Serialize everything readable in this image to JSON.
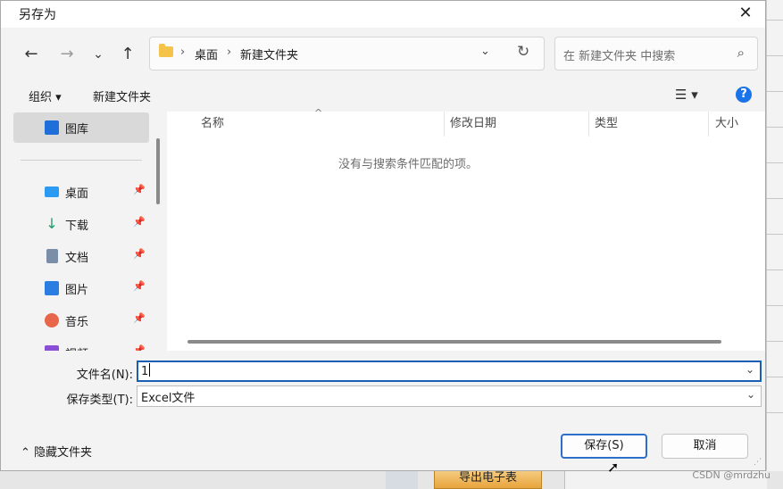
{
  "dialog": {
    "title": "另存为",
    "close_icon": "close-icon"
  },
  "nav": {
    "back": "←",
    "forward": "→",
    "recent": "⌄",
    "up": "↑",
    "breadcrumb": [
      "桌面",
      "新建文件夹"
    ],
    "crumb_sep": "›",
    "dropdown": "⌄",
    "refresh": "↻",
    "search_placeholder": "在 新建文件夹 中搜索",
    "search_icon": "⌕"
  },
  "toolbar": {
    "organize": "组织 ▾",
    "new_folder": "新建文件夹",
    "view": "☰ ▾",
    "help": "?"
  },
  "sidebar": {
    "items": [
      {
        "label": "图库",
        "icon": "gallery-icon",
        "color": "#1e6fd9",
        "pinned": false
      },
      {
        "label": "桌面",
        "icon": "desktop-icon",
        "color": "#2b9af3",
        "pinned": true
      },
      {
        "label": "下载",
        "icon": "download-icon",
        "color": "#1a9c6b",
        "pinned": true
      },
      {
        "label": "文档",
        "icon": "documents-icon",
        "color": "#7b8ea8",
        "pinned": true
      },
      {
        "label": "图片",
        "icon": "pictures-icon",
        "color": "#2a7de1",
        "pinned": true
      },
      {
        "label": "音乐",
        "icon": "music-icon",
        "color": "#e8674a",
        "pinned": true
      },
      {
        "label": "视频",
        "icon": "videos-icon",
        "color": "#8a4fd6",
        "pinned": true
      }
    ],
    "pin_glyph": "📌"
  },
  "file_list": {
    "columns": [
      "名称",
      "修改日期",
      "类型",
      "大小"
    ],
    "sort_glyph": "^",
    "empty_message": "没有与搜索条件匹配的项。"
  },
  "fields": {
    "filename_label": "文件名(N):",
    "filename_value": "1",
    "filetype_label": "保存类型(T):",
    "filetype_value": "Excel文件",
    "chevron": "⌄"
  },
  "footer": {
    "hide_folders": "隐藏文件夹",
    "save": "保存(S)",
    "cancel": "取消"
  },
  "background": {
    "export_button": "导出电子表",
    "watermark": "CSDN @mrdzhu"
  },
  "colors": {
    "accent": "#1a5fb4",
    "panel": "#f3f3f3"
  }
}
